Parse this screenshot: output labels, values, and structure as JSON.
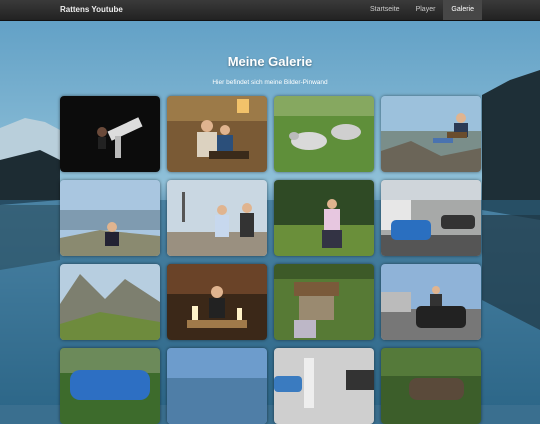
{
  "navbar": {
    "brand": "Rattens Youtube",
    "items": [
      {
        "label": "Startseite",
        "active": false
      },
      {
        "label": "Player",
        "active": false
      },
      {
        "label": "Galerie",
        "active": true
      }
    ]
  },
  "header": {
    "title": "Meine Galerie",
    "subtitle": "Hier befindet sich meine Bilder-Pinwand"
  },
  "gallery": {
    "thumbnails": [
      {
        "subject": "telescope at night"
      },
      {
        "subject": "two people in restaurant"
      },
      {
        "subject": "goats on grass"
      },
      {
        "subject": "person on mountain chair"
      },
      {
        "subject": "person on summit panorama"
      },
      {
        "subject": "two people on mountain"
      },
      {
        "subject": "person in forest clearing"
      },
      {
        "subject": "blue car in parking lot"
      },
      {
        "subject": "alpine rocky valley"
      },
      {
        "subject": "person with candles"
      },
      {
        "subject": "bird house in garden"
      },
      {
        "subject": "person sitting on car"
      },
      {
        "subject": "blue car on street"
      },
      {
        "subject": "mountain sky view"
      },
      {
        "subject": "parking garage"
      },
      {
        "subject": "car in forest"
      }
    ]
  }
}
